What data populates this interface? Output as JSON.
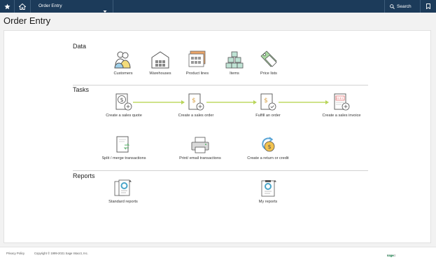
{
  "topbar": {
    "app_title": "Order Entry",
    "search_label": "Search",
    "icons": [
      "star-icon",
      "home-icon",
      "chevron-down-icon",
      "search-icon",
      "bookmark-icon"
    ],
    "color": "#1c3b5a"
  },
  "page": {
    "title": "Order Entry"
  },
  "sections": {
    "data": {
      "title": "Data",
      "items": [
        {
          "label": "Customers",
          "icon": "customers-icon"
        },
        {
          "label": "Warehouses",
          "icon": "warehouse-icon"
        },
        {
          "label": "Product lines",
          "icon": "product-lines-icon"
        },
        {
          "label": "Items",
          "icon": "items-icon"
        },
        {
          "label": "Price lists",
          "icon": "price-tag-icon"
        }
      ]
    },
    "tasks": {
      "title": "Tasks",
      "flow": [
        {
          "label": "Create a sales quote",
          "icon": "sales-quote-icon"
        },
        {
          "label": "Create a sales order",
          "icon": "sales-order-icon"
        },
        {
          "label": "Fulfill an order",
          "icon": "fulfill-order-icon"
        },
        {
          "label": "Create a sales invoice",
          "icon": "sales-invoice-icon"
        }
      ],
      "other": [
        {
          "label": "Split / merge transactions",
          "icon": "split-merge-icon"
        },
        {
          "label": "Print/ email transactions",
          "icon": "printer-icon"
        },
        {
          "label": "Create a return or credit",
          "icon": "return-credit-icon"
        }
      ]
    },
    "reports": {
      "title": "Reports",
      "items": [
        {
          "label": "Standard reports",
          "icon": "standard-reports-icon"
        },
        {
          "label": "My reports",
          "icon": "my-reports-icon"
        }
      ]
    }
  },
  "footer": {
    "privacy": "Privacy Policy",
    "copyright": "Copyright © 1999-2021 Sage Intacct, Inc.",
    "brand_sage": "sage",
    "brand_intacct": "Intacct"
  },
  "colors": {
    "accent_green": "#00a651",
    "flow_arrow": "#cfe38a"
  }
}
